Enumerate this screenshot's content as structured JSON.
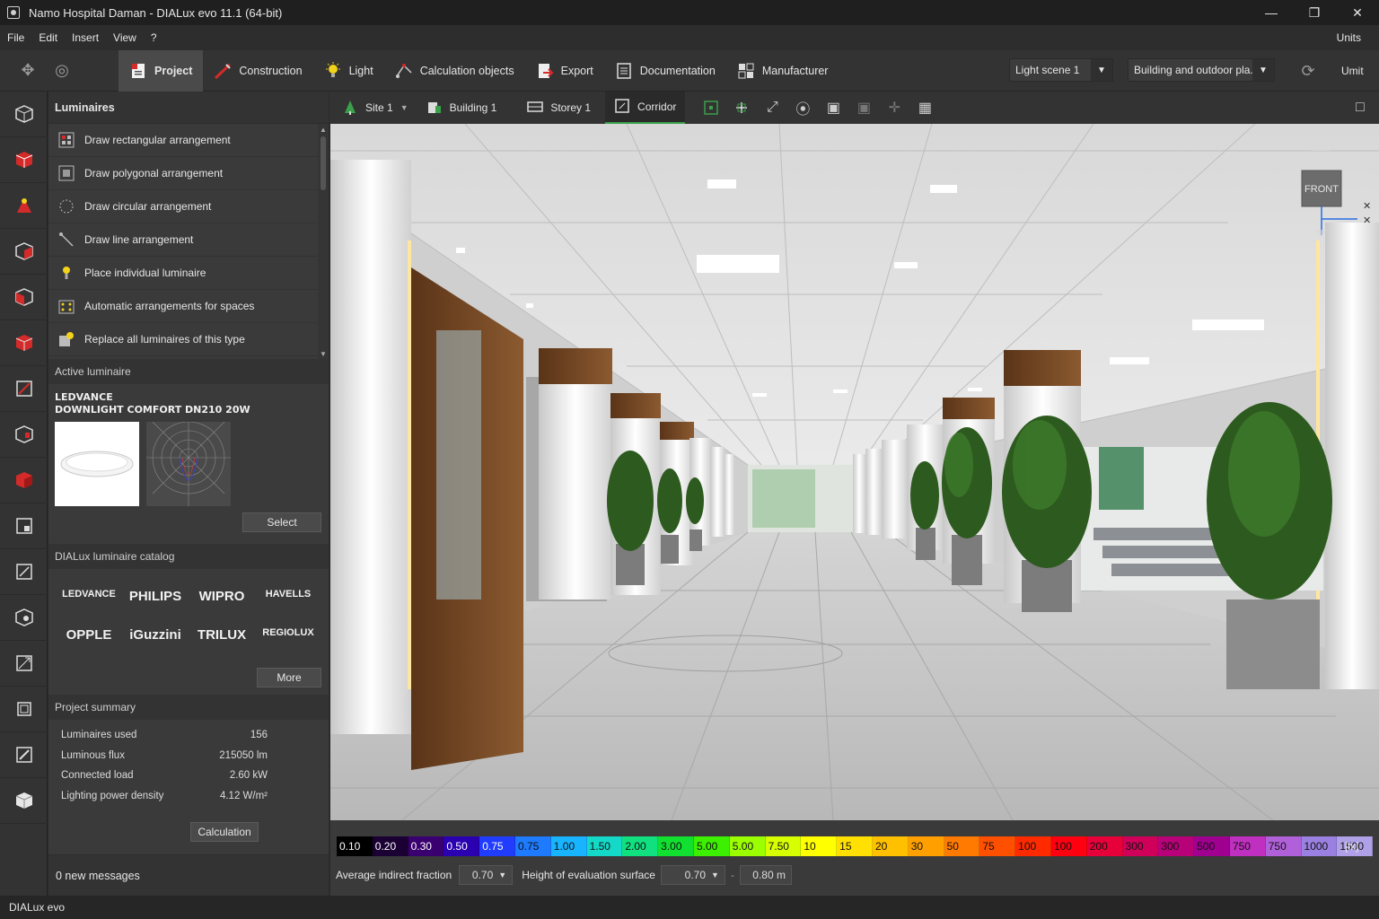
{
  "window": {
    "title": "Namo Hospital Daman - DIALux evo 11.1 (64-bit)"
  },
  "menu": {
    "items": [
      "File",
      "Edit",
      "Insert",
      "View",
      "?"
    ],
    "units": "Units"
  },
  "ribbon": {
    "tabs": [
      {
        "label": "Project",
        "icon": "project-icon"
      },
      {
        "label": "Construction",
        "icon": "construction-icon"
      },
      {
        "label": "Light",
        "icon": "light-bulb-icon"
      },
      {
        "label": "Calculation objects",
        "icon": "calculation-objects-icon"
      },
      {
        "label": "Export",
        "icon": "export-icon"
      },
      {
        "label": "Documentation",
        "icon": "documentation-icon"
      },
      {
        "label": "Manufacturer",
        "icon": "manufacturer-icon"
      }
    ],
    "light_scene": "Light scene 1",
    "view_mode": "Building and outdoor pla...",
    "right_button": "Umit"
  },
  "luminaires": {
    "title": "Luminaires",
    "items": [
      "Draw rectangular arrangement",
      "Draw polygonal arrangement",
      "Draw circular arrangement",
      "Draw line arrangement",
      "Place individual luminaire",
      "Automatic arrangements for spaces",
      "Replace all luminaires of this type"
    ]
  },
  "active_luminaire": {
    "title": "Active luminaire",
    "manufacturer": "LEDVANCE",
    "model": "DOWNLIGHT COMFORT DN210 20W",
    "select_label": "Select"
  },
  "catalog": {
    "title": "DIALux luminaire catalog",
    "brands": [
      "LEDVANCE",
      "PHILIPS",
      "WIPRO",
      "HAVELLS",
      "OPPLE",
      "iGuzzini",
      "TRILUX",
      "REGIOLUX"
    ],
    "more_label": "More"
  },
  "summary": {
    "title": "Project summary",
    "rows": [
      {
        "label": "Luminaires used",
        "value": "156"
      },
      {
        "label": "Luminous flux",
        "value": "215050 lm"
      },
      {
        "label": "Connected load",
        "value": "2.60 kW"
      },
      {
        "label": "Lighting power density",
        "value": "4.12 W/m²"
      }
    ],
    "calc_label": "Calculation"
  },
  "messages": "0 new messages",
  "breadcrumbs": [
    {
      "label": "Site 1",
      "icon": "site-icon"
    },
    {
      "label": "Building 1",
      "icon": "building-icon"
    },
    {
      "label": "Storey 1",
      "icon": "storey-icon"
    },
    {
      "label": "Corridor",
      "icon": "room-icon"
    }
  ],
  "view_cube": {
    "label": "FRONT"
  },
  "scale": {
    "values": [
      "0.10",
      "0.20",
      "0.30",
      "0.50",
      "0.75",
      "0.75",
      "1.00",
      "1.50",
      "2.00",
      "3.00",
      "5.00",
      "5.00",
      "7.50",
      "10",
      "15",
      "20",
      "30",
      "50",
      "75",
      "100",
      "100",
      "200",
      "300",
      "300",
      "500",
      "750",
      "750",
      "1000",
      "1500"
    ],
    "colors": [
      "#000000",
      "#1a0033",
      "#3a0070",
      "#2a00b0",
      "#1f3cff",
      "#1e7bff",
      "#18b4ff",
      "#14d9c8",
      "#10e080",
      "#12e030",
      "#3cf000",
      "#9cff00",
      "#d8ff00",
      "#ffff00",
      "#ffe000",
      "#ffc000",
      "#ffa000",
      "#ff7a00",
      "#ff5000",
      "#ff2a00",
      "#ff0010",
      "#e8003a",
      "#d0005a",
      "#b80078",
      "#a00090",
      "#c030c0",
      "#b060d8",
      "#9a80e0",
      "#b0a0e8"
    ],
    "unit": "[lx]"
  },
  "eval": {
    "indirect_label": "Average indirect fraction",
    "indirect_value": "0.70",
    "height_label": "Height of evaluation surface",
    "height_value": "0.70",
    "height_value2": "0.80 m"
  },
  "status": "DIALux evo"
}
